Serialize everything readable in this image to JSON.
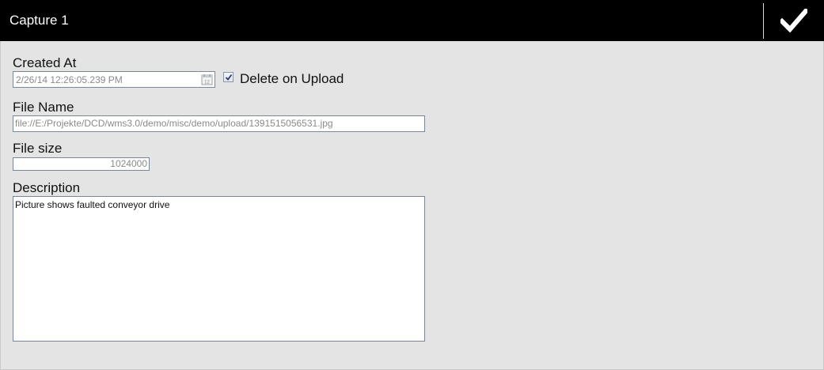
{
  "header": {
    "title": "Capture 1",
    "confirm_icon": "checkmark-icon"
  },
  "form": {
    "created_at": {
      "label": "Created At",
      "value": "2/26/14 12:26:05.239 PM",
      "icon": "calendar-icon"
    },
    "delete_on_upload": {
      "label": "Delete on Upload",
      "checked": true
    },
    "file_name": {
      "label": "File Name",
      "value": "file://E:/Projekte/DCD/wms3.0/demo/misc/demo/upload/1391515056531.jpg"
    },
    "file_size": {
      "label": "File size",
      "value": "1024000"
    },
    "description": {
      "label": "Description",
      "value": "Picture shows faulted conveyor drive"
    }
  },
  "colors": {
    "header_bg": "#000000",
    "page_bg": "#e4e4e4",
    "field_border": "#7a8699",
    "readonly_text": "#8a8a8a"
  }
}
